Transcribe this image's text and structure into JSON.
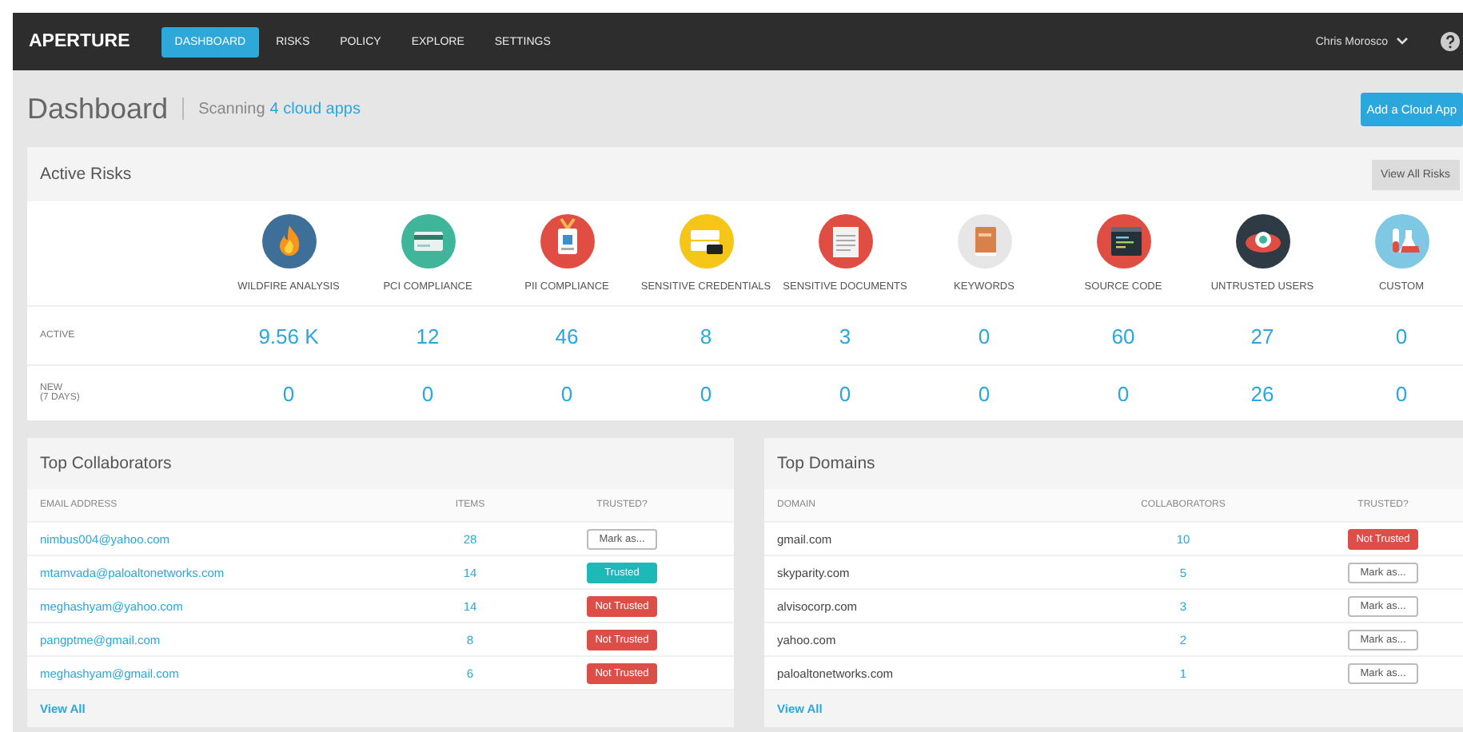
{
  "navbar": {
    "logo": "APERTURE",
    "tabs": [
      {
        "label": "DASHBOARD",
        "selected": true
      },
      {
        "label": "RISKS",
        "selected": false
      },
      {
        "label": "POLICY",
        "selected": false
      },
      {
        "label": "EXPLORE",
        "selected": false
      },
      {
        "label": "SETTINGS",
        "selected": false
      }
    ],
    "user": "Chris Morosco"
  },
  "header": {
    "title": "Dashboard",
    "scanning": "Scanning",
    "apps_link": "4 cloud apps",
    "add_button": "Add a Cloud App"
  },
  "active_risks": {
    "title": "Active Risks",
    "view_all": "View All Risks",
    "row_labels": [
      "ACTIVE",
      "NEW\n(7 DAYS)"
    ],
    "categories": [
      {
        "label": "WILDFIRE ANALYSIS",
        "kind": "flame",
        "color": "#3d6f99",
        "active": "9.56 K",
        "new": "0"
      },
      {
        "label": "PCI COMPLIANCE",
        "kind": "card",
        "color": "#3fb59a",
        "active": "12",
        "new": "0"
      },
      {
        "label": "PII COMPLIANCE",
        "kind": "badge",
        "color": "#e04e43",
        "active": "46",
        "new": "0"
      },
      {
        "label": "SENSITIVE CREDENTIALS",
        "kind": "credentials",
        "color": "#f5c518",
        "active": "8",
        "new": "0"
      },
      {
        "label": "SENSITIVE DOCUMENTS",
        "kind": "document",
        "color": "#e04e43",
        "active": "3",
        "new": "0"
      },
      {
        "label": "KEYWORDS",
        "kind": "book",
        "color": "#e6e6e6",
        "active": "0",
        "new": "0"
      },
      {
        "label": "SOURCE CODE",
        "kind": "code",
        "color": "#e04e43",
        "active": "60",
        "new": "0"
      },
      {
        "label": "UNTRUSTED USERS",
        "kind": "eye",
        "color": "#2e3b44",
        "active": "27",
        "new": "26"
      },
      {
        "label": "CUSTOM",
        "kind": "flask",
        "color": "#7ec8e3",
        "active": "0",
        "new": "0"
      }
    ]
  },
  "top_collaborators": {
    "title": "Top Collaborators",
    "columns": [
      "EMAIL ADDRESS",
      "ITEMS",
      "TRUSTED?"
    ],
    "rows": [
      {
        "email": "nimbus004@yahoo.com",
        "items": "28",
        "trust": {
          "kind": "mark",
          "label": "Mark as..."
        }
      },
      {
        "email": "mtamvada@paloaltonetworks.com",
        "items": "14",
        "trust": {
          "kind": "trusted",
          "label": "Trusted"
        }
      },
      {
        "email": "meghashyam@yahoo.com",
        "items": "14",
        "trust": {
          "kind": "not_trusted",
          "label": "Not Trusted"
        }
      },
      {
        "email": "pangptme@gmail.com",
        "items": "8",
        "trust": {
          "kind": "not_trusted",
          "label": "Not Trusted"
        }
      },
      {
        "email": "meghashyam@gmail.com",
        "items": "6",
        "trust": {
          "kind": "not_trusted",
          "label": "Not Trusted"
        }
      }
    ],
    "view_all": "View All"
  },
  "top_domains": {
    "title": "Top Domains",
    "columns": [
      "DOMAIN",
      "COLLABORATORS",
      "TRUSTED?"
    ],
    "rows": [
      {
        "domain": "gmail.com",
        "collaborators": "10",
        "trust": {
          "kind": "not_trusted",
          "label": "Not Trusted"
        }
      },
      {
        "domain": "skyparity.com",
        "collaborators": "5",
        "trust": {
          "kind": "mark",
          "label": "Mark as..."
        }
      },
      {
        "domain": "alvisocorp.com",
        "collaborators": "3",
        "trust": {
          "kind": "mark",
          "label": "Mark as..."
        }
      },
      {
        "domain": "yahoo.com",
        "collaborators": "2",
        "trust": {
          "kind": "mark",
          "label": "Mark as..."
        }
      },
      {
        "domain": "paloaltonetworks.com",
        "collaborators": "1",
        "trust": {
          "kind": "mark",
          "label": "Mark as..."
        }
      }
    ],
    "view_all": "View All"
  }
}
